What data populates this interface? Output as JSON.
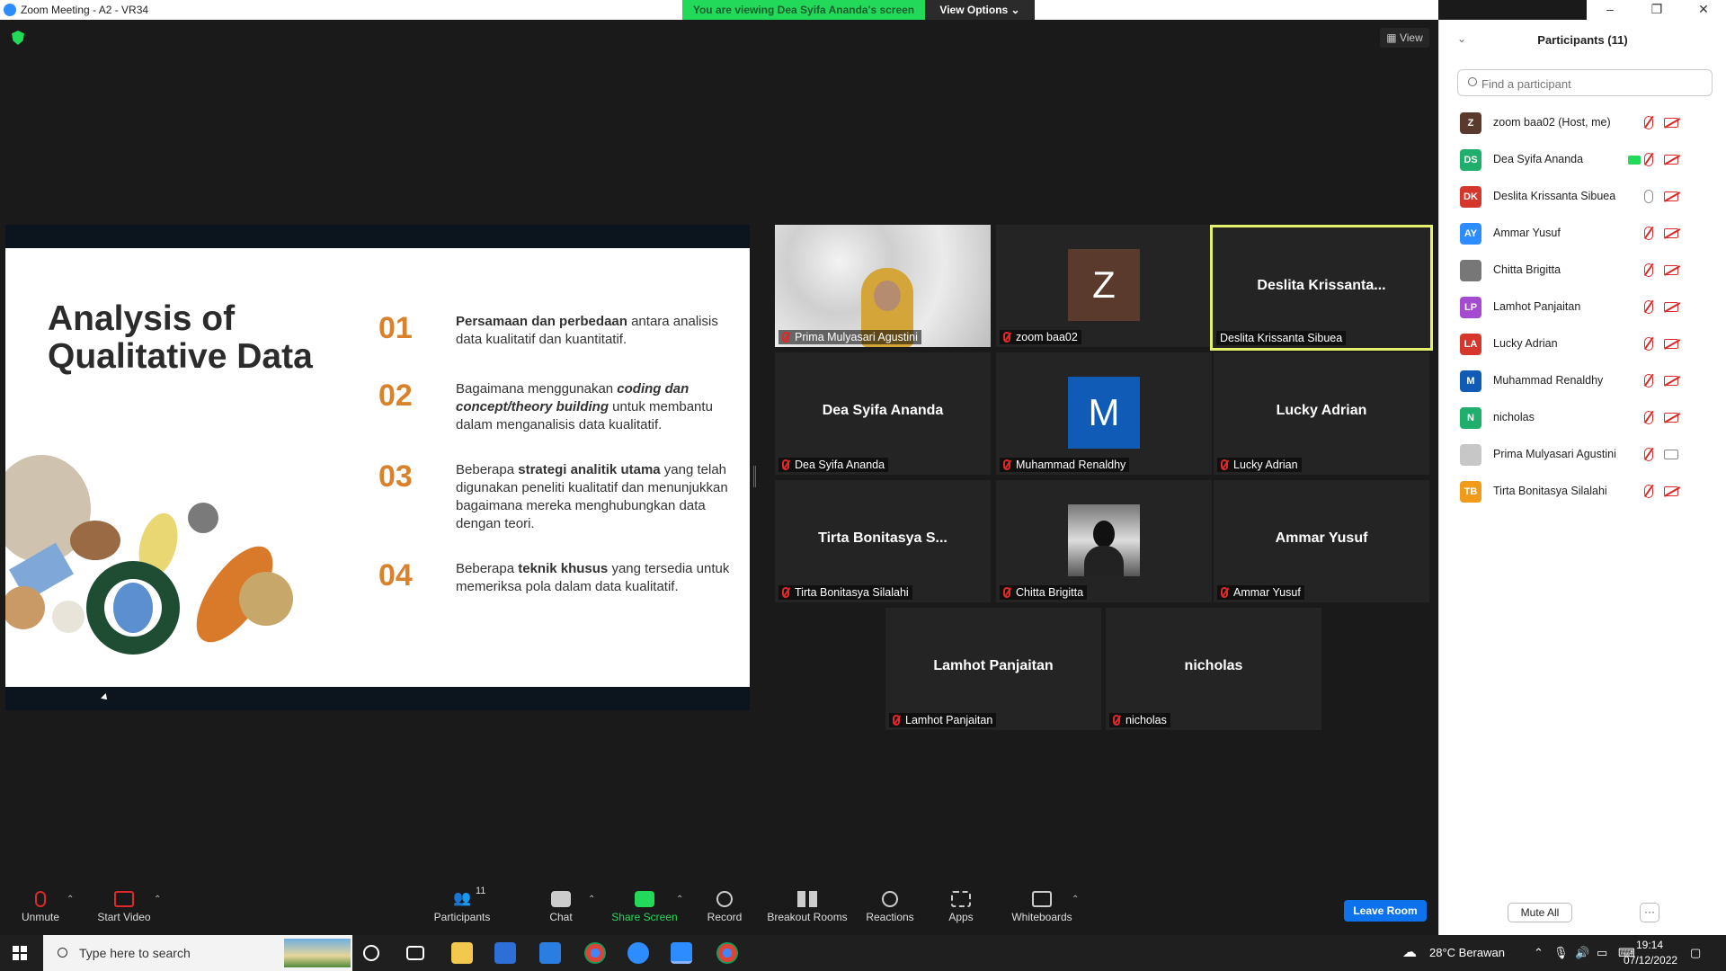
{
  "window": {
    "title": "Zoom Meeting - A2 - VR34",
    "viewing_banner": "You are viewing Dea Syifa Ananda's screen",
    "view_options": "View Options ⌄",
    "controls": [
      "–",
      "❐",
      "✕"
    ]
  },
  "meeting": {
    "view_label": "View"
  },
  "slide": {
    "title": "Analysis of Qualitative Data",
    "items": [
      {
        "num": "01",
        "bold": "Persamaan dan perbedaan",
        "rest": " antara analisis data kualitatif dan kuantitatif."
      },
      {
        "num": "02",
        "pre": "Bagaimana menggunakan ",
        "bold": "coding dan concept/theory building",
        "rest": " untuk membantu dalam menganalisis data kualitatif."
      },
      {
        "num": "03",
        "pre": "Beberapa ",
        "bold": "strategi analitik utama",
        "rest": " yang telah digunakan peneliti kualitatif dan menunjukkan bagaimana mereka menghubungkan data dengan teori."
      },
      {
        "num": "04",
        "pre": "Beberapa ",
        "bold": "teknik khusus",
        "rest": " yang tersedia untuk memeriksa pola dalam data kualitatif."
      }
    ]
  },
  "gallery": [
    {
      "center": "",
      "label": "Prima Mulyasari Agustini",
      "muted": true,
      "avatar": "photo-prima"
    },
    {
      "center": "",
      "label": "zoom baa02",
      "muted": true,
      "avatar": "Z",
      "avatar_color": "#5b3a2e"
    },
    {
      "center": "Deslita  Krissanta...",
      "label": "Deslita Krissanta Sibuea",
      "muted": false,
      "active": true
    },
    {
      "center": "Dea Syifa Ananda",
      "label": "Dea Syifa Ananda",
      "muted": true
    },
    {
      "center": "",
      "label": "Muhammad Renaldhy",
      "muted": true,
      "avatar": "M",
      "avatar_color": "#0f5bb5"
    },
    {
      "center": "Lucky Adrian",
      "label": "Lucky Adrian",
      "muted": true
    },
    {
      "center": "Tirta Bonitasya S...",
      "label": "Tirta Bonitasya Silalahi",
      "muted": true
    },
    {
      "center": "",
      "label": "Chitta Brigitta",
      "muted": true,
      "avatar": "photo-chitta"
    },
    {
      "center": "Ammar Yusuf",
      "label": "Ammar Yusuf",
      "muted": true
    },
    {
      "center": "Lamhot Panjaitan",
      "label": "Lamhot Panjaitan",
      "muted": true
    },
    {
      "center": "nicholas",
      "label": "nicholas",
      "muted": true
    }
  ],
  "toolbar": {
    "unmute": "Unmute",
    "start_video": "Start Video",
    "participants": "Participants",
    "participants_count": "11",
    "chat": "Chat",
    "share_screen": "Share Screen",
    "record": "Record",
    "breakout_rooms": "Breakout Rooms",
    "reactions": "Reactions",
    "apps": "Apps",
    "whiteboards": "Whiteboards",
    "leave": "Leave Room"
  },
  "panel": {
    "title": "Participants (11)",
    "search_placeholder": "Find a participant",
    "participants": [
      {
        "initials": "Z",
        "color": "#5b3a2e",
        "name": "zoom baa02 (Host, me)",
        "mic": "off",
        "cam": "off"
      },
      {
        "initials": "DS",
        "color": "#1fae6b",
        "name": "Dea Syifa Ananda",
        "mic": "off",
        "cam": "off",
        "sharing": true
      },
      {
        "initials": "DK",
        "color": "#d6372c",
        "name": "Deslita Krissanta Sibuea",
        "mic": "on",
        "cam": "off"
      },
      {
        "initials": "AY",
        "color": "#2d8cff",
        "name": "Ammar Yusuf",
        "mic": "off",
        "cam": "off"
      },
      {
        "initials": "",
        "color": "#777777",
        "name": "Chitta Brigitta",
        "mic": "off",
        "cam": "off",
        "photo": true
      },
      {
        "initials": "LP",
        "color": "#a54bd1",
        "name": "Lamhot Panjaitan",
        "mic": "off",
        "cam": "off"
      },
      {
        "initials": "LA",
        "color": "#d6372c",
        "name": "Lucky Adrian",
        "mic": "off",
        "cam": "off"
      },
      {
        "initials": "M",
        "color": "#0f5bb5",
        "name": "Muhammad Renaldhy",
        "mic": "off",
        "cam": "off"
      },
      {
        "initials": "N",
        "color": "#1fae6b",
        "name": "nicholas",
        "mic": "off",
        "cam": "off"
      },
      {
        "initials": "",
        "color": "#c7c7c7",
        "name": "Prima Mulyasari Agustini",
        "mic": "off",
        "cam": "on",
        "photo": true
      },
      {
        "initials": "TB",
        "color": "#f29a1a",
        "name": "Tirta Bonitasya Silalahi",
        "mic": "off",
        "cam": "off"
      }
    ],
    "mute_all": "Mute All",
    "more": "···"
  },
  "taskbar": {
    "search_text": "Type here to search",
    "weather": "28°C  Berawan",
    "time": "19:14",
    "date": "07/12/2022"
  }
}
